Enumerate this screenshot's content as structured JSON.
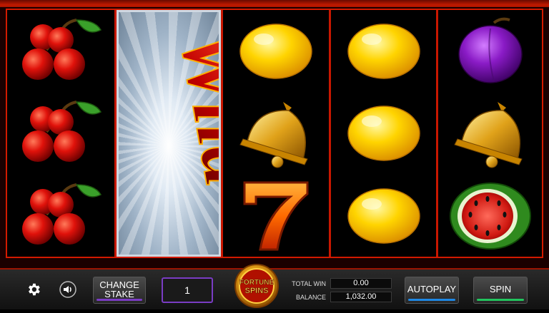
{
  "controls": {
    "change_stake_line1": "CHANGE",
    "change_stake_line2": "STAKE",
    "stake_value": "1",
    "autoplay_label": "AUTOPLAY",
    "spin_label": "SPIN",
    "total_win_label": "TOTAL WIN",
    "total_win_value": "0.00",
    "balance_label": "BALANCE",
    "balance_value": "1,032.00"
  },
  "logo": {
    "line1": "FORTUNE",
    "line2": "SPINS"
  },
  "wild": {
    "text": "Wild"
  },
  "reels": [
    [
      "cherries",
      "cherries",
      "cherries"
    ],
    [
      "wild"
    ],
    [
      "lemon",
      "bell",
      "seven"
    ],
    [
      "lemon",
      "lemon",
      "lemon"
    ],
    [
      "plum",
      "bell",
      "watermelon"
    ]
  ],
  "colors": {
    "accent_red": "#c81700",
    "stake_purple": "#7a3cc4",
    "autoplay_blue": "#1e88e5",
    "spin_green": "#22c55e"
  }
}
